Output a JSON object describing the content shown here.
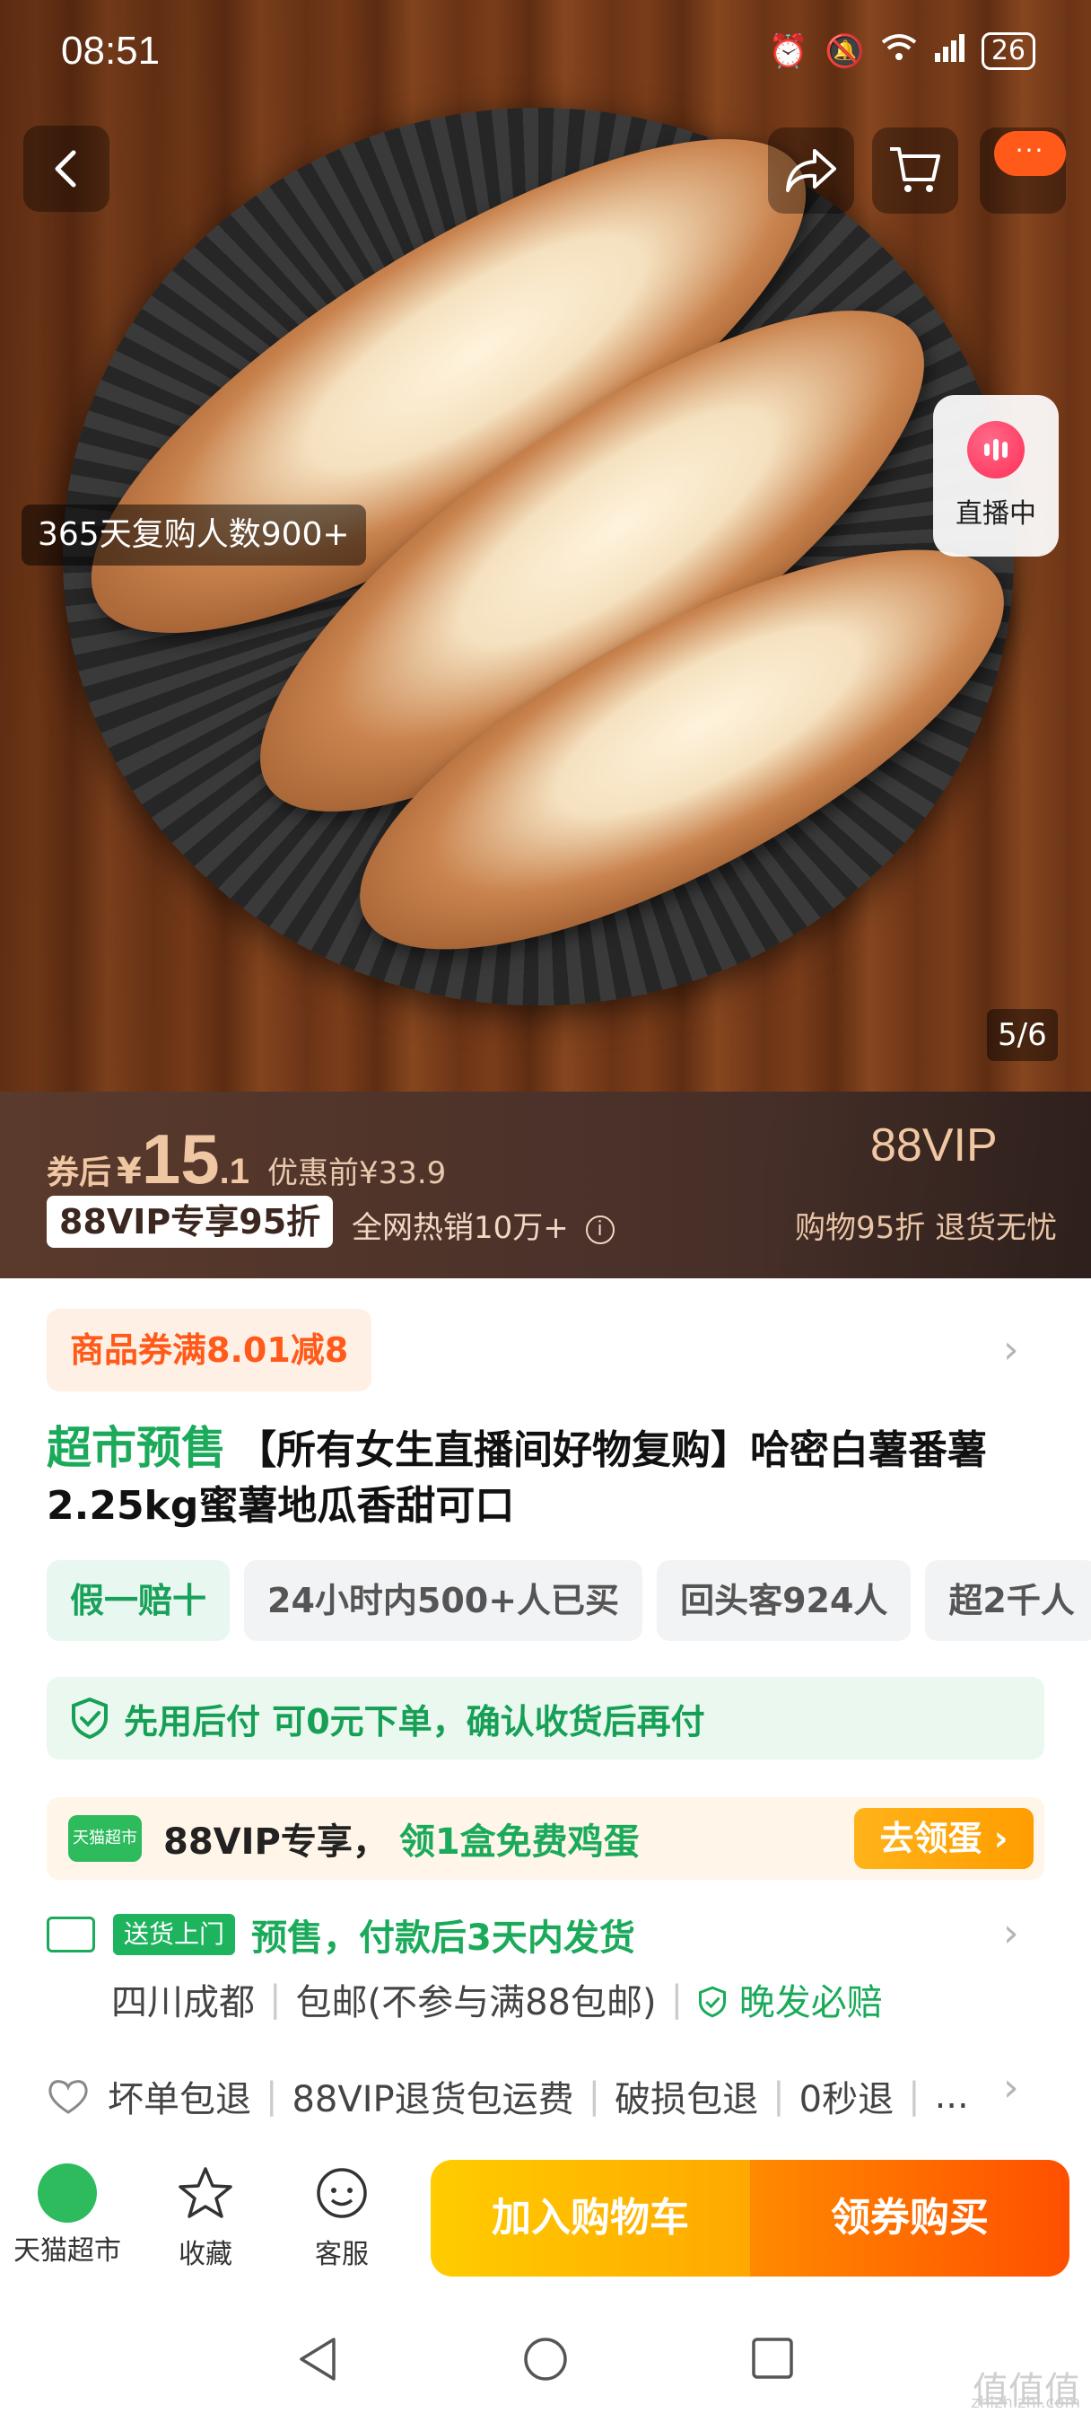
{
  "status_bar": {
    "time": "08:51",
    "battery": "26"
  },
  "hero": {
    "repurchase": "365天复购人数900+",
    "live_label": "直播中",
    "page_counter": "5/6",
    "more_dots": "···"
  },
  "price": {
    "coupon_label": "券后",
    "currency": "¥",
    "integer": "15",
    "decimal": ".1",
    "original": "优惠前¥33.9",
    "vip_discount": "88VIP专享95折",
    "hot_sales": "全网热销10万+",
    "info_mark": "i",
    "vip_title": "88VIP",
    "vip_sub": "购物95折 退货无忧"
  },
  "coupon": {
    "label": "商品券满8.01减8"
  },
  "product": {
    "presale": "超市预售",
    "title": "【所有女生直播间好物复购】哈密白薯番薯2.25kg蜜薯地瓜香甜可口"
  },
  "tags": [
    {
      "label": "假一赔十"
    },
    {
      "label": "24小时内500+人已买"
    },
    {
      "label": "回头客924人"
    },
    {
      "label": "超2千人"
    }
  ],
  "pay_later": {
    "text": "先用后付 可0元下单，确认收货后再付"
  },
  "vip_egg": {
    "logo": "天猫超市",
    "prefix": "88VIP专享，",
    "offer": "领1盒免费鸡蛋",
    "button": "去领蛋 ›"
  },
  "shipping": {
    "badge": "送货上门",
    "text": "预售，付款后3天内发货",
    "origin": "四川成都",
    "postage": "包邮(不参与满88包邮)",
    "late_comp": "晚发必赔"
  },
  "guarantee": {
    "items": [
      "坏单包退",
      "88VIP退货包运费",
      "破损包退",
      "0秒退"
    ],
    "more": "..."
  },
  "bottom_bar": {
    "shop": "天猫超市",
    "favorite": "收藏",
    "service": "客服",
    "add_cart": "加入购物车",
    "buy_now": "领券购买"
  },
  "watermark": {
    "main": "值值值",
    "sub": "zhizhizhi.com"
  },
  "colors": {
    "accent_green": "#1aaa5a",
    "accent_orange": "#ff5a1a",
    "price_gold": "#f0c7a3"
  }
}
